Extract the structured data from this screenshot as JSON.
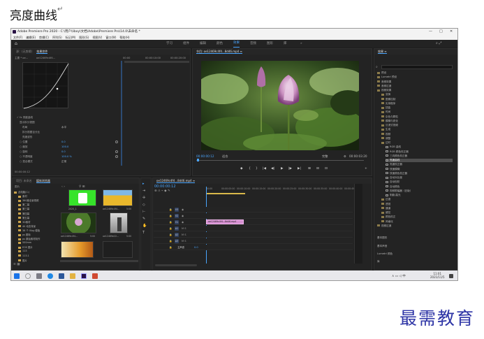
{
  "document": {
    "title": "亮度曲线",
    "paragraph_mark": "↵",
    "brand": "最需教育"
  },
  "window": {
    "title": "Adobe Premiere Pro 2020 - C:\\用户\\liboy\\文档\\Adobe\\Premiere Pro\\14.0\\未命名 *",
    "controls": [
      "—",
      "□",
      "✕"
    ]
  },
  "menu": [
    "文件(F)",
    "编辑(E)",
    "剪辑(C)",
    "序列(S)",
    "标记(M)",
    "图形(G)",
    "视图(V)",
    "窗口(W)",
    "帮助(H)"
  ],
  "workspaces": {
    "items": [
      "学习",
      "组件",
      "编辑",
      "颜色",
      "效果",
      "音频",
      "图形",
      "库"
    ],
    "active_index": 4
  },
  "effect_controls": {
    "tabs": [
      "源：(无剪辑)",
      "效果控件"
    ],
    "clip_label": "主要 * oe...",
    "sequence_label": "oe12469c4f4...",
    "timecodes": [
      "00:00",
      "00:00:10:00",
      "00:00:20:00"
    ],
    "rows": [
      {
        "label": "✓ fx 亮度曲线",
        "value": ""
      },
      {
        "label": "显示拆分视图",
        "value": ""
      },
      {
        "label": "布局",
        "value": "水平"
      },
      {
        "label": "拆分视图百分比",
        "value": ""
      },
      {
        "label": "亮度波形",
        "value": ""
      },
      {
        "label": "○ 位置",
        "value": "0.0"
      },
      {
        "label": "○ 缩放",
        "value": "100.0"
      },
      {
        "label": "○ 旋转",
        "value": "0.0"
      },
      {
        "label": "○ 不透明度",
        "value": "100.0 %"
      },
      {
        "label": "○ 混合模式",
        "value": "正常"
      }
    ],
    "footer_time": "00:00:00:12"
  },
  "program_monitor": {
    "title": "节目: oe12469c4f4...8d46.mp4 ≡",
    "timecode_current": "00:00:00:12",
    "fit_label": "适合",
    "quality_label": "完整",
    "timecode_duration": "00:00:03:20",
    "controls": [
      "◆",
      "{",
      "}",
      "|◀",
      "◀|",
      "▶",
      "|▶",
      "▶|",
      "⊞",
      "⊟",
      "⊡",
      "+"
    ]
  },
  "effects_panel": {
    "title": "效果 ≡",
    "items": [
      {
        "label": "预设",
        "type": "folder",
        "level": 0
      },
      {
        "label": "Lumetri 预设",
        "type": "folder",
        "level": 0
      },
      {
        "label": "音频效果",
        "type": "folder",
        "level": 0
      },
      {
        "label": "音频过渡",
        "type": "folder",
        "level": 0
      },
      {
        "label": "视频效果",
        "type": "folder",
        "level": 0
      },
      {
        "label": "变换",
        "type": "folder",
        "level": 1
      },
      {
        "label": "图像控制",
        "type": "folder",
        "level": 1
      },
      {
        "label": "实用程序",
        "type": "folder",
        "level": 1
      },
      {
        "label": "扭曲",
        "type": "folder",
        "level": 1
      },
      {
        "label": "时间",
        "type": "folder",
        "level": 1
      },
      {
        "label": "杂色与颗粒",
        "type": "folder",
        "level": 1
      },
      {
        "label": "模糊与锐化",
        "type": "folder",
        "level": 1
      },
      {
        "label": "沉浸式视频",
        "type": "folder",
        "level": 1
      },
      {
        "label": "生成",
        "type": "folder",
        "level": 1
      },
      {
        "label": "视频",
        "type": "folder",
        "level": 1
      },
      {
        "label": "调整",
        "type": "folder",
        "level": 1
      },
      {
        "label": "过时",
        "type": "folder",
        "level": 1
      },
      {
        "label": "RGB 曲线",
        "type": "effect",
        "level": 2
      },
      {
        "label": "RGB 颜色校正器",
        "type": "effect",
        "level": 2
      },
      {
        "label": "三向颜色校正器",
        "type": "effect",
        "level": 2
      },
      {
        "label": "亮度曲线",
        "type": "effect",
        "level": 2,
        "selected": true
      },
      {
        "label": "亮度校正器",
        "type": "effect",
        "level": 2
      },
      {
        "label": "快速模糊",
        "type": "effect",
        "level": 2
      },
      {
        "label": "快速颜色校正器",
        "type": "effect",
        "level": 2
      },
      {
        "label": "自动对比度",
        "type": "effect",
        "level": 2
      },
      {
        "label": "自动色阶",
        "type": "effect",
        "level": 2
      },
      {
        "label": "自动颜色",
        "type": "effect",
        "level": 2
      },
      {
        "label": "视频限幅器（旧版）",
        "type": "effect",
        "level": 2
      },
      {
        "label": "阴影/高光",
        "type": "effect",
        "level": 2
      },
      {
        "label": "过渡",
        "type": "folder",
        "level": 1
      },
      {
        "label": "透视",
        "type": "folder",
        "level": 1
      },
      {
        "label": "通道",
        "type": "folder",
        "level": 1
      },
      {
        "label": "键控",
        "type": "folder",
        "level": 1
      },
      {
        "label": "颜色校正",
        "type": "folder",
        "level": 1
      },
      {
        "label": "风格化",
        "type": "folder",
        "level": 1
      },
      {
        "label": "视频过渡",
        "type": "folder",
        "level": 0
      }
    ],
    "bottom_sections": [
      "基本图形",
      "基本声音",
      "Lumetri 颜色",
      "库"
    ]
  },
  "project_panel": {
    "tabs": [
      "项目: 未命名",
      "媒体浏览器"
    ],
    "drive_label": "图片",
    "folders": [
      "此电脑(C:)",
      "素材",
      "360度全景视频",
      "第二幕",
      "第三幕",
      "第四幕",
      "第五幕",
      "3D素材",
      "4K 动态背景",
      "36 个 Vlog 模板",
      "ps 图标",
      "ps 原始素材制作",
      "500mm",
      "EOS 图片",
      "113",
      "113.1",
      "图片"
    ],
    "thumbnails": [
      {
        "label": "2020_1",
        "duration": "",
        "kind": "green-icon"
      },
      {
        "label": "oe12469c4f4...",
        "duration": "5:00",
        "kind": "sunflower"
      },
      {
        "label": "oe12469c4f4...",
        "duration": "5:00",
        "kind": "lotus"
      },
      {
        "label": "oe12469e22...",
        "duration": "5:00",
        "kind": "gray"
      },
      {
        "label": "",
        "duration": "",
        "kind": "flower-orange"
      },
      {
        "label": "",
        "duration": "",
        "kind": "dark"
      }
    ]
  },
  "timeline": {
    "title": "oe12469c4f4...8d46.mp4 ≡",
    "timecode": "00:00:00:12",
    "ruler": [
      "00:00",
      "00:00:05:00",
      "00:00:10:00",
      "00:00:15:00",
      "00:00:20:00",
      "00:00:25:00",
      "00:00:30:00",
      "00:00:35:00",
      "00:00:40:00",
      "00:00:45:00"
    ],
    "tracks": [
      "V3",
      "V2",
      "V1",
      "A1",
      "A2",
      "A3",
      "主声道"
    ],
    "master_value": "0.0",
    "clip_label": "oe12469c4f4...8d46.mp4"
  },
  "taskbar": {
    "time": "11:01",
    "date": "2021/11/5"
  }
}
